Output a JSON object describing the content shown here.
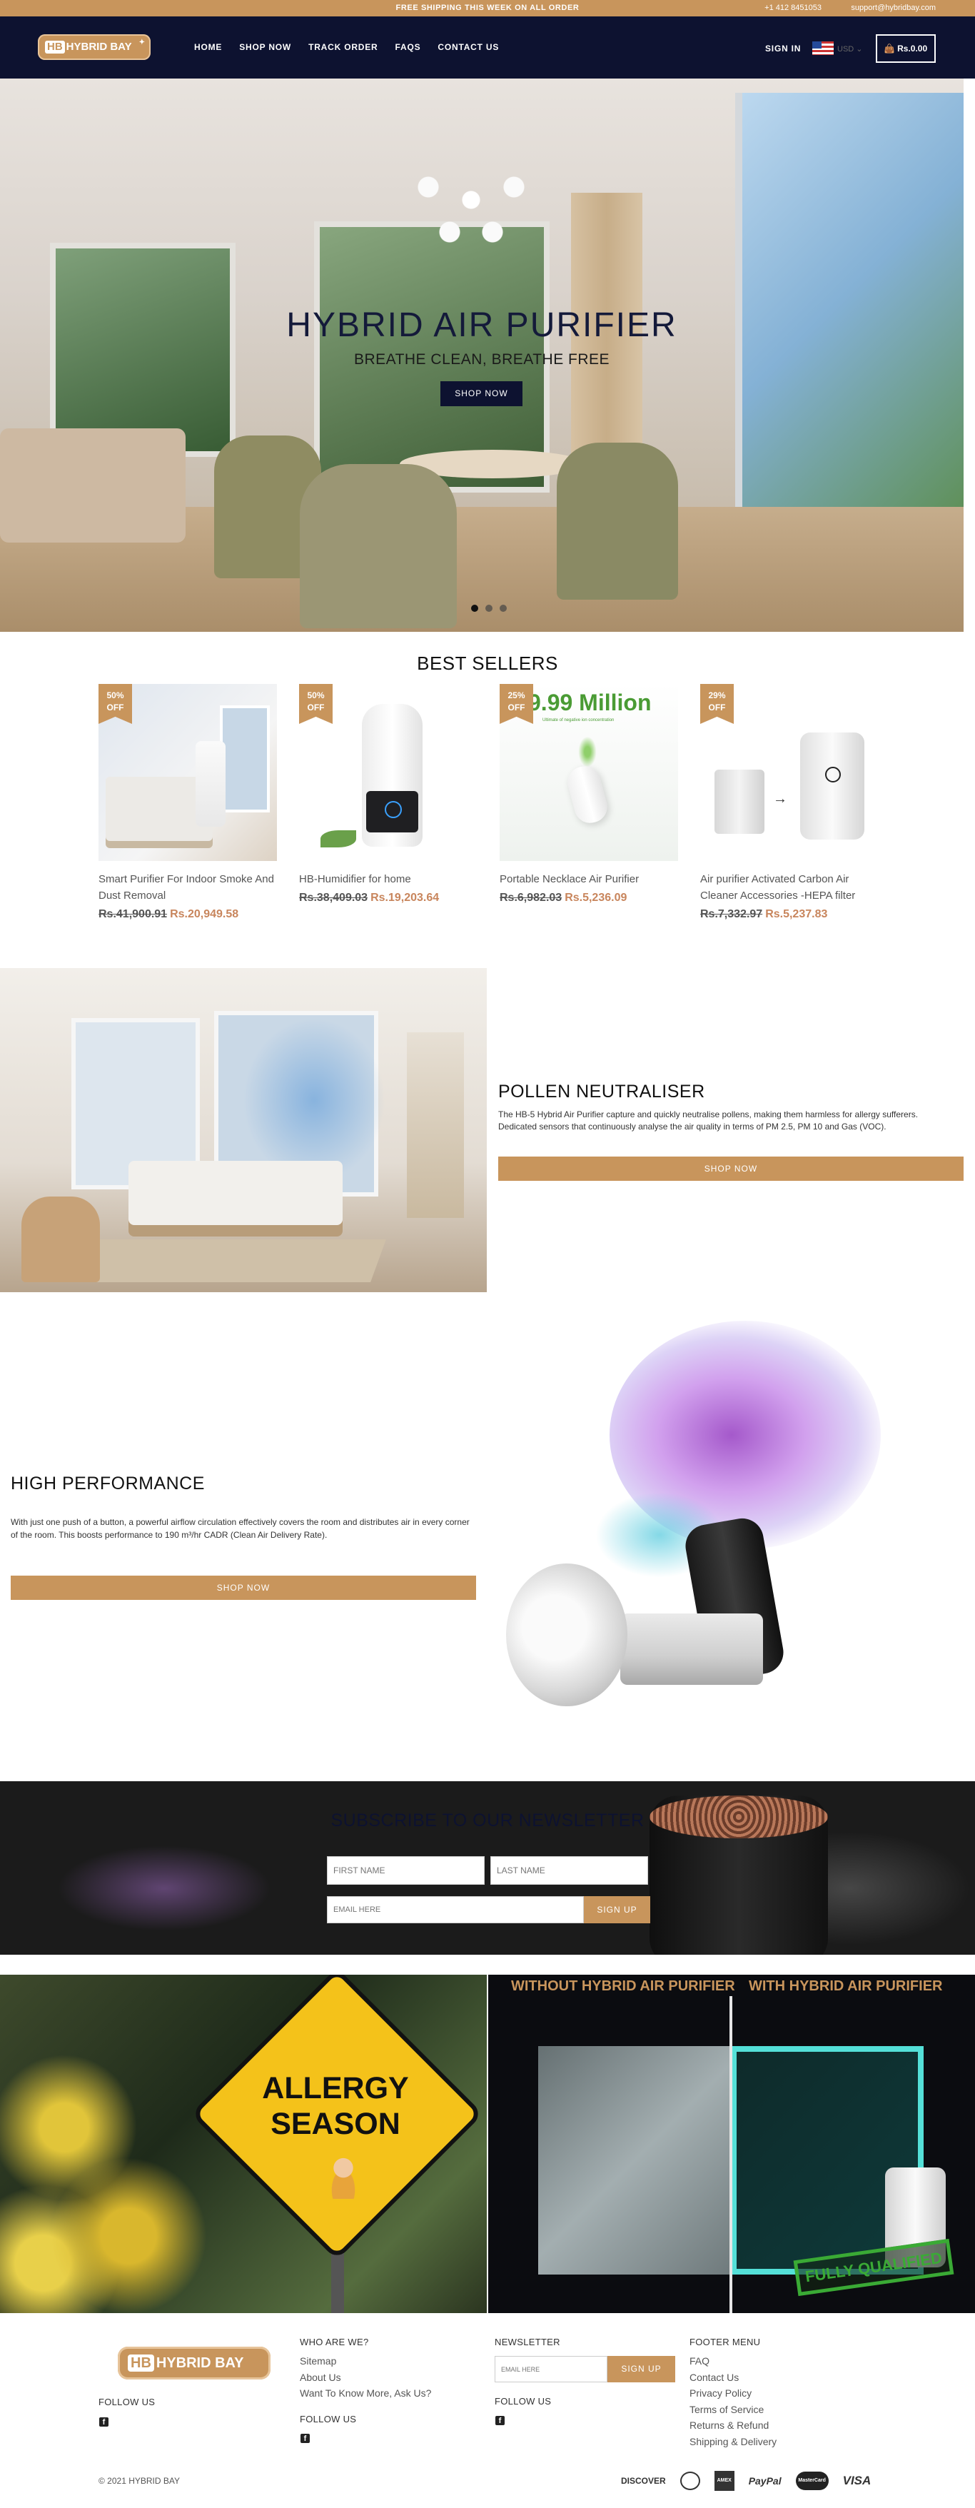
{
  "announcement": {
    "message": "FREE SHIPPING THIS WEEK ON ALL ORDER",
    "phone": "+1 412 8451053",
    "email": "support@hybridbay.com"
  },
  "header": {
    "logo_hb": "HB",
    "logo_text": "HYBRID BAY",
    "nav": [
      "HOME",
      "SHOP NOW",
      "TRACK ORDER",
      "FAQS",
      "CONTACT US"
    ],
    "signin": "SIGN IN",
    "currency": "USD ⌄",
    "cart": "Rs.0.00",
    "cart_icon": "bag-icon"
  },
  "hero": {
    "title": "HYBRID AIR PURIFIER",
    "subtitle": "BREATHE CLEAN, BREATHE FREE",
    "button": "SHOP NOW"
  },
  "best_sellers": {
    "title": "BEST SELLERS",
    "products": [
      {
        "badge": "50%\nOFF",
        "name": "Smart Purifier For Indoor Smoke And Dust Removal",
        "old_price": "Rs.41,900.91",
        "new_price": "Rs.20,949.58"
      },
      {
        "badge": "50%\nOFF",
        "name": "HB-Humidifier for home",
        "old_price": "Rs.38,409.03",
        "new_price": "Rs.19,203.64"
      },
      {
        "badge": "25%\nOFF",
        "name": "Portable Necklace Air Purifier",
        "old_price": "Rs.6,982.03",
        "new_price": "Rs.5,236.09",
        "image_text": "9.99 Million",
        "image_subtext": "Ultimate of negative ion concentration"
      },
      {
        "badge": "29%\nOFF",
        "name": "Air purifier Activated Carbon Air Cleaner Accessories -HEPA filter",
        "old_price": "Rs.7,332.97",
        "new_price": "Rs.5,237.83"
      }
    ]
  },
  "pollen": {
    "title": "POLLEN NEUTRALISER",
    "text1": "The HB-5 Hybrid Air Purifier capture and quickly neutralise pollens, making them harmless for allergy sufferers.",
    "text2": "Dedicated sensors that continuously analyse the air quality in terms of PM 2.5, PM 10 and Gas (VOC).",
    "button": "SHOP NOW"
  },
  "performance": {
    "title": "HIGH PERFORMANCE",
    "text": "With just one push of a button, a powerful airflow circulation effectively covers the room and distributes air in every corner of the room. This boosts performance to 190 m³/hr CADR (Clean Air Delivery Rate).",
    "button": "SHOP NOW"
  },
  "newsletter": {
    "title": "SUBSCRIBE TO OUR NEWSLETTER",
    "first_name": "FIRST NAME",
    "last_name": "LAST NAME",
    "email": "EMAIL HERE",
    "button": "SIGN UP"
  },
  "banners": {
    "allergy_line1": "ALLERGY",
    "allergy_line2": "SEASON",
    "without": "WITHOUT HYBRID AIR PURIFIER",
    "with": "WITH HYBRID AIR PURIFIER",
    "stamp": "FULLY QUALIFIED"
  },
  "footer": {
    "logo_hb": "HB",
    "logo_text": "HYBRID BAY",
    "follow": "FOLLOW US",
    "who_title": "WHO ARE WE?",
    "who_links": [
      "Sitemap",
      "About Us",
      "Want To Know More, Ask Us?"
    ],
    "newsletter_title": "NEWSLETTER",
    "email_placeholder": "EMAIL HERE",
    "signup": "SIGN UP",
    "menu_title": "FOOTER MENU",
    "menu_links": [
      "FAQ",
      "Contact Us",
      "Privacy Policy",
      "Terms of Service",
      "Returns & Refund",
      "Shipping & Delivery"
    ],
    "copyright": "© 2021 HYBRID BAY",
    "payments": [
      "DISCOVER",
      "DINERS CLUB",
      "AMEX",
      "PayPal",
      "MasterCard",
      "VISA"
    ]
  },
  "colors": {
    "accent": "#c8955c",
    "navy": "#0d1230"
  }
}
